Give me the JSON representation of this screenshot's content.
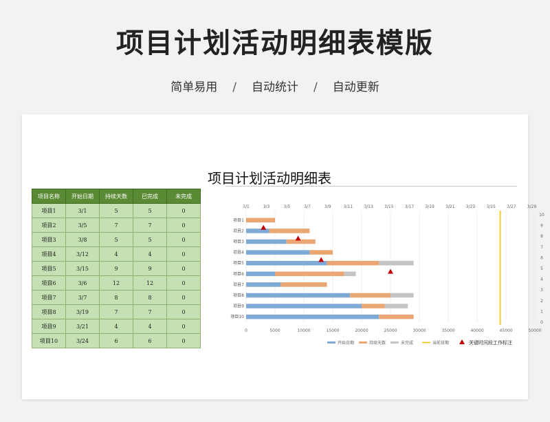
{
  "header": {
    "title": "项目计划活动明细表模版",
    "subtitle_items": [
      "简单易用",
      "自动统计",
      "自动更新"
    ],
    "separator": "/"
  },
  "sheet": {
    "title": "项目计划活动明细表",
    "columns": [
      "项目名称",
      "开始日期",
      "持续天数",
      "已完成",
      "未完成"
    ],
    "rows": [
      [
        "项目1",
        "3/1",
        "5",
        "5",
        "0"
      ],
      [
        "项目2",
        "3/5",
        "7",
        "7",
        "0"
      ],
      [
        "项目3",
        "3/8",
        "5",
        "5",
        "0"
      ],
      [
        "项目4",
        "3/12",
        "4",
        "4",
        "0"
      ],
      [
        "项目5",
        "3/15",
        "9",
        "9",
        "0"
      ],
      [
        "项目6",
        "3/6",
        "12",
        "12",
        "0"
      ],
      [
        "项目7",
        "3/7",
        "8",
        "8",
        "0"
      ],
      [
        "项目8",
        "3/19",
        "7",
        "7",
        "0"
      ],
      [
        "项目9",
        "3/21",
        "4",
        "4",
        "0"
      ],
      [
        "项目10",
        "3/24",
        "6",
        "6",
        "0"
      ]
    ]
  },
  "chart_data": {
    "type": "bar",
    "orientation": "horizontal-stacked",
    "categories": [
      "项目1",
      "项目2",
      "项目3",
      "项目4",
      "项目5",
      "项目6",
      "项目7",
      "项目8",
      "项目9",
      "项目10"
    ],
    "series": [
      {
        "name": "开始日期",
        "color": "#7eaad5",
        "values": [
          0,
          4000,
          7000,
          11000,
          14000,
          5000,
          6000,
          18000,
          20000,
          23000
        ]
      },
      {
        "name": "持续天数",
        "color": "#eaa773",
        "values": [
          5000,
          7000,
          5000,
          4000,
          9000,
          12000,
          8000,
          7000,
          4000,
          6000
        ]
      },
      {
        "name": "未完成",
        "color": "#c4c4c4",
        "values": [
          0,
          0,
          0,
          0,
          6000,
          2000,
          0,
          4000,
          4000,
          0
        ]
      }
    ],
    "x_bottom": {
      "ticks": [
        0,
        5000,
        10000,
        15000,
        20000,
        25000,
        30000,
        35000,
        40000,
        45000,
        50000
      ],
      "range": [
        0,
        50000
      ]
    },
    "x_top": {
      "ticks": [
        "3/1",
        "3/3",
        "3/5",
        "3/7",
        "3/9",
        "3/11",
        "3/13",
        "3/15",
        "3/17",
        "3/19",
        "3/21",
        "3/23",
        "3/25",
        "3/27",
        "3/29"
      ]
    },
    "y_right": {
      "ticks": [
        0,
        1,
        2,
        3,
        4,
        5,
        6,
        7,
        8,
        9,
        10
      ],
      "range": [
        0,
        10
      ]
    },
    "current_date_line": {
      "name": "当前日期",
      "color": "#f5c400",
      "x": 44000
    },
    "key_markers": {
      "name": "关键时间段工作标注",
      "color": "#c00000",
      "points": [
        {
          "x": 3000,
          "y": 8.8
        },
        {
          "x": 9000,
          "y": 7.8
        },
        {
          "x": 13000,
          "y": 5.8
        },
        {
          "x": 25000,
          "y": 4.7
        }
      ]
    },
    "legend": [
      "开始日期",
      "持续天数",
      "未完成",
      "当前日期",
      "关键时间段工作标注"
    ],
    "legend_position": "bottom"
  }
}
